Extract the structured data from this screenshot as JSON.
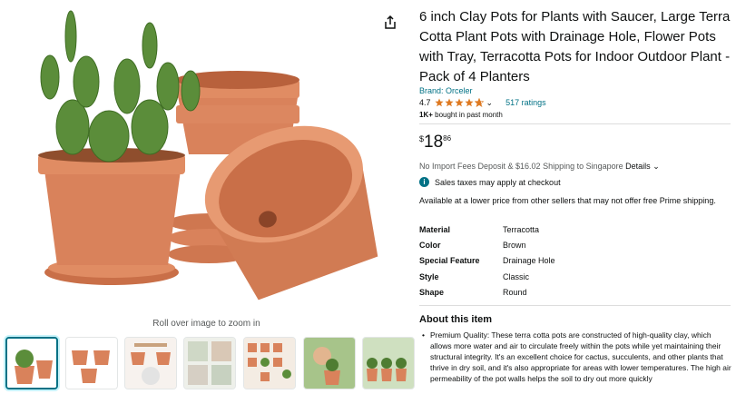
{
  "gallery": {
    "zoom_hint": "Roll over image to zoom in",
    "thumbnails": [
      {
        "selected": true
      },
      {
        "selected": false
      },
      {
        "selected": false
      },
      {
        "selected": false
      },
      {
        "selected": false
      },
      {
        "selected": false
      },
      {
        "selected": false
      }
    ]
  },
  "product": {
    "title": "6 inch Clay Pots for Plants with Saucer, Large Terra Cotta Plant Pots with Drainage Hole, Flower Pots with Tray, Terracotta Pots for Indoor Outdoor Plant - Pack of 4 Planters",
    "brand": "Brand: Orceler",
    "rating_value": "4.7",
    "rating_stars": 4.7,
    "ratings_count": "517 ratings",
    "bought_strong": "1K+",
    "bought_rest": " bought in past month",
    "price": {
      "currency": "$",
      "whole": "18",
      "fraction": "86"
    },
    "import_text": "No Import Fees Deposit & $16.02 Shipping to Singapore",
    "details_link": "Details",
    "tax_note": "Sales taxes may apply at checkout",
    "availability_note": "Available at a lower price from other sellers that may not offer free Prime shipping.",
    "specs": [
      {
        "key": "Material",
        "value": "Terracotta"
      },
      {
        "key": "Color",
        "value": "Brown"
      },
      {
        "key": "Special Feature",
        "value": "Drainage Hole"
      },
      {
        "key": "Style",
        "value": "Classic"
      },
      {
        "key": "Shape",
        "value": "Round"
      }
    ],
    "about_title": "About this item",
    "about_items": [
      "Premium Quality: These terra cotta pots are constructed of high-quality clay, which allows more water and air to circulate freely within the pots while yet maintaining their structural integrity. It's an excellent choice for cactus, succulents, and other plants that thrive in dry soil, and it's also appropriate for areas with lower temperatures. The high air permeability of the pot walls helps the soil to dry out more quickly"
    ]
  },
  "colors": {
    "link": "#007185",
    "star": "#de7921",
    "terracotta": "#d9825b",
    "terracotta_dark": "#b8613c",
    "cactus": "#5b8d3a"
  }
}
